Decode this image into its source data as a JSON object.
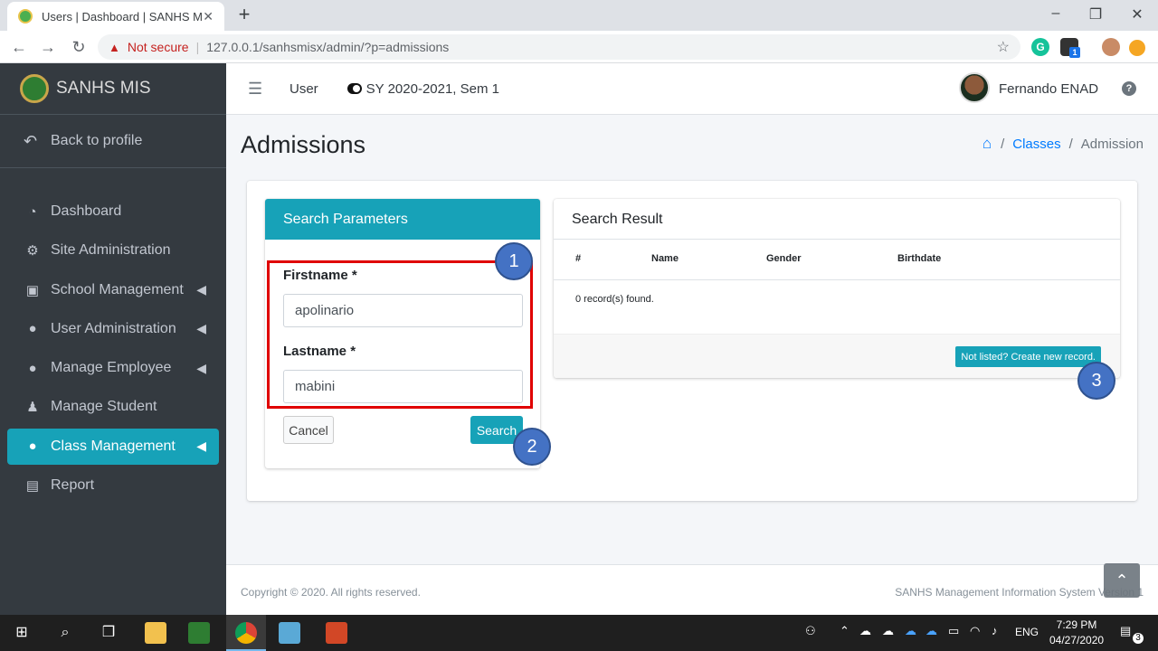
{
  "browser": {
    "tab_title": "Users | Dashboard | SANHS MIS",
    "tab_close": "✕",
    "new_tab": "+",
    "security_label": "Not secure",
    "url": "127.0.0.1/sanhsmisx/admin/?p=admissions",
    "win_min": "–",
    "win_max": "❐",
    "win_close": "✕",
    "ext_grammarly": "G",
    "ext_badge": "1"
  },
  "sidebar": {
    "brand": "SANHS MIS",
    "back_label": "Back to profile",
    "items": [
      {
        "label": "Dashboard",
        "icon": "tachometer-icon"
      },
      {
        "label": "Site Administration",
        "icon": "cogs-icon"
      },
      {
        "label": "School Management",
        "icon": "school-icon"
      },
      {
        "label": "User Administration",
        "icon": "user-icon"
      },
      {
        "label": "Manage Employee",
        "icon": "user-icon"
      },
      {
        "label": "Manage Student",
        "icon": "graduate-icon"
      },
      {
        "label": "Class Management",
        "icon": "user-icon"
      },
      {
        "label": "Report",
        "icon": "file-icon"
      }
    ]
  },
  "topnav": {
    "user_label": "User",
    "school_year": "SY 2020-2021, Sem 1",
    "username": "Fernando ENAD",
    "help": "?"
  },
  "page": {
    "title": "Admissions",
    "breadcrumb_classes": "Classes",
    "breadcrumb_current": "Admission",
    "breadcrumb_sep": "/"
  },
  "search_card": {
    "title": "Search Parameters",
    "firstname_label": "Firstname *",
    "firstname_value": "apolinario",
    "lastname_label": "Lastname *",
    "lastname_value": "mabini",
    "cancel_label": "Cancel",
    "search_label": "Search"
  },
  "result_card": {
    "title": "Search Result",
    "columns": [
      "#",
      "Name",
      "Gender",
      "Birthdate"
    ],
    "empty_text": "0 record(s) found.",
    "create_label": "Not listed? Create new record."
  },
  "callouts": [
    "1",
    "2",
    "3"
  ],
  "footer": {
    "copyright": "Copyright © 2020. All rights reserved.",
    "system_name": "SANHS Management Information System Version 1"
  },
  "taskbar": {
    "language": "ENG",
    "time": "7:29 PM",
    "date": "04/27/2020",
    "notif_count": "3"
  },
  "colors": {
    "sidebar_bg": "#343a40",
    "accent": "#17a2b8",
    "link": "#007bff",
    "callout": "#4472c4",
    "highlight_box": "#e00000"
  }
}
